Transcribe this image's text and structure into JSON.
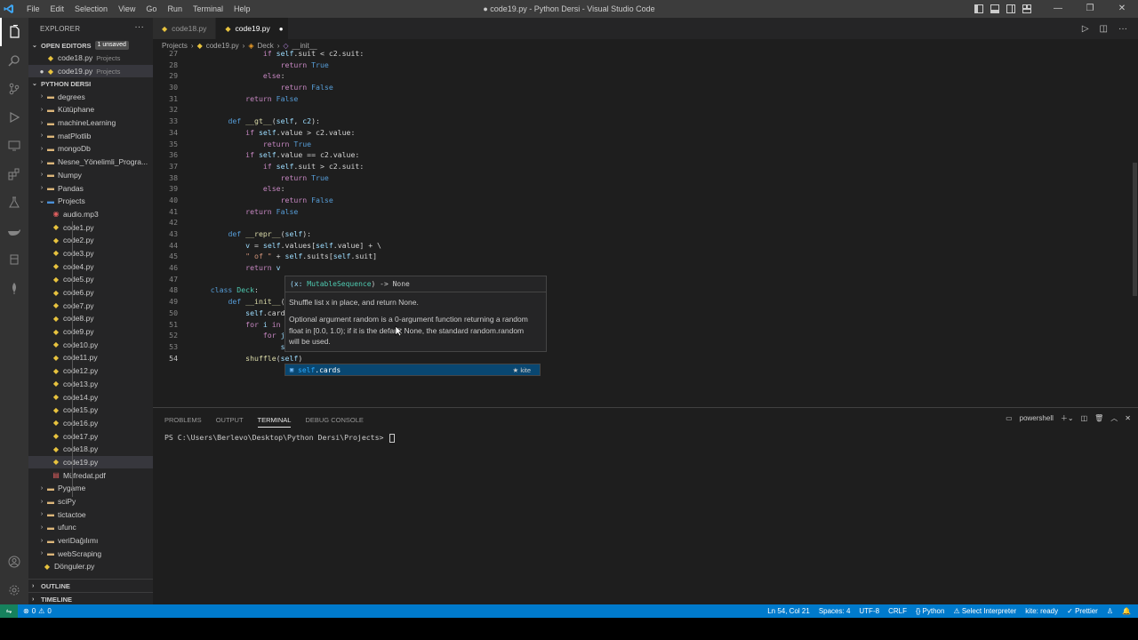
{
  "titlebar": {
    "menu": [
      "File",
      "Edit",
      "Selection",
      "View",
      "Go",
      "Run",
      "Terminal",
      "Help"
    ],
    "title": "● code19.py - Python Dersi - Visual Studio Code",
    "controls": [
      "—",
      "❐",
      "✕"
    ]
  },
  "sidebar": {
    "header": "EXPLORER",
    "open_editors": {
      "label": "OPEN EDITORS",
      "badge": "1 unsaved"
    },
    "open_files": [
      {
        "name": "code18.py",
        "folder": "Projects"
      },
      {
        "name": "code19.py",
        "folder": "Projects"
      }
    ],
    "workspace": "PYTHON DERSI",
    "folders_top": [
      "degrees",
      "Kütüphane",
      "machineLearning",
      "matPlotlib",
      "mongoDb",
      "Nesne_Yönelimli_Progra...",
      "Numpy",
      "Pandas"
    ],
    "projects_folder": "Projects",
    "project_files": [
      "audio.mp3",
      "code1.py",
      "code2.py",
      "code3.py",
      "code4.py",
      "code5.py",
      "code6.py",
      "code7.py",
      "code8.py",
      "code9.py",
      "code10.py",
      "code11.py",
      "code12.py",
      "code13.py",
      "code14.py",
      "code15.py",
      "code16.py",
      "code17.py",
      "code18.py",
      "code19.py",
      "Müfredat.pdf"
    ],
    "folders_bottom": [
      "Pygame",
      "sciPy",
      "tictactoe",
      "ufunc",
      "veriDağılımı",
      "webScraping"
    ],
    "file_bottom": "Dönguler.py",
    "outline": "OUTLINE",
    "timeline": "TIMELINE"
  },
  "tabs": [
    {
      "label": "code18.py"
    },
    {
      "label": "code19.py"
    }
  ],
  "breadcrumb": [
    "Projects",
    "code19.py",
    "Deck",
    "__init__"
  ],
  "code": {
    "lines": [
      {
        "n": "27",
        "segs": [
          [
            "                ",
            ""
          ],
          [
            "if ",
            "kw2"
          ],
          [
            "self",
            "self"
          ],
          [
            ".suit < c2.suit:",
            ""
          ]
        ]
      },
      {
        "n": "28",
        "segs": [
          [
            "                    ",
            ""
          ],
          [
            "return ",
            "kw2"
          ],
          [
            "True",
            "kw"
          ]
        ]
      },
      {
        "n": "29",
        "segs": [
          [
            "                ",
            ""
          ],
          [
            "else",
            "kw2"
          ],
          [
            ":",
            ""
          ]
        ]
      },
      {
        "n": "30",
        "segs": [
          [
            "                    ",
            ""
          ],
          [
            "return ",
            "kw2"
          ],
          [
            "False",
            "kw"
          ]
        ]
      },
      {
        "n": "31",
        "segs": [
          [
            "            ",
            ""
          ],
          [
            "return ",
            "kw2"
          ],
          [
            "False",
            "kw"
          ]
        ]
      },
      {
        "n": "32",
        "segs": [
          [
            "",
            ""
          ]
        ]
      },
      {
        "n": "33",
        "segs": [
          [
            "        ",
            ""
          ],
          [
            "def ",
            "kw"
          ],
          [
            "__gt__",
            "fnc"
          ],
          [
            "(",
            ""
          ],
          [
            "self",
            "self"
          ],
          [
            ", ",
            ""
          ],
          [
            "c2",
            "vr"
          ],
          [
            "):",
            ""
          ]
        ]
      },
      {
        "n": "34",
        "segs": [
          [
            "            ",
            ""
          ],
          [
            "if ",
            "kw2"
          ],
          [
            "self",
            "self"
          ],
          [
            ".value > c2.value:",
            ""
          ]
        ]
      },
      {
        "n": "35",
        "segs": [
          [
            "                ",
            ""
          ],
          [
            "return ",
            "kw2"
          ],
          [
            "True",
            "kw"
          ]
        ]
      },
      {
        "n": "36",
        "segs": [
          [
            "            ",
            ""
          ],
          [
            "if ",
            "kw2"
          ],
          [
            "self",
            "self"
          ],
          [
            ".value == c2.value:",
            ""
          ]
        ]
      },
      {
        "n": "37",
        "segs": [
          [
            "                ",
            ""
          ],
          [
            "if ",
            "kw2"
          ],
          [
            "self",
            "self"
          ],
          [
            ".suit > c2.suit:",
            ""
          ]
        ]
      },
      {
        "n": "38",
        "segs": [
          [
            "                    ",
            ""
          ],
          [
            "return ",
            "kw2"
          ],
          [
            "True",
            "kw"
          ]
        ]
      },
      {
        "n": "39",
        "segs": [
          [
            "                ",
            ""
          ],
          [
            "else",
            "kw2"
          ],
          [
            ":",
            ""
          ]
        ]
      },
      {
        "n": "40",
        "segs": [
          [
            "                    ",
            ""
          ],
          [
            "return ",
            "kw2"
          ],
          [
            "False",
            "kw"
          ]
        ]
      },
      {
        "n": "41",
        "segs": [
          [
            "            ",
            ""
          ],
          [
            "return ",
            "kw2"
          ],
          [
            "False",
            "kw"
          ]
        ]
      },
      {
        "n": "42",
        "segs": [
          [
            "",
            ""
          ]
        ]
      },
      {
        "n": "43",
        "segs": [
          [
            "        ",
            ""
          ],
          [
            "def ",
            "kw"
          ],
          [
            "__repr__",
            "fnc"
          ],
          [
            "(",
            ""
          ],
          [
            "self",
            "self"
          ],
          [
            "):",
            ""
          ]
        ]
      },
      {
        "n": "44",
        "segs": [
          [
            "            ",
            ""
          ],
          [
            "v",
            "vr"
          ],
          [
            " = ",
            ""
          ],
          [
            "self",
            "self"
          ],
          [
            ".values[",
            ""
          ],
          [
            "self",
            "self"
          ],
          [
            ".value] + \\",
            ""
          ]
        ]
      },
      {
        "n": "45",
        "segs": [
          [
            "            ",
            ""
          ],
          [
            "\" of \"",
            "str"
          ],
          [
            " + ",
            ""
          ],
          [
            "self",
            "self"
          ],
          [
            ".suits[",
            ""
          ],
          [
            "self",
            "self"
          ],
          [
            ".suit]",
            ""
          ]
        ]
      },
      {
        "n": "46",
        "segs": [
          [
            "            ",
            ""
          ],
          [
            "return ",
            "kw2"
          ],
          [
            "v",
            "vr"
          ]
        ]
      },
      {
        "n": "47",
        "segs": [
          [
            "",
            ""
          ]
        ]
      },
      {
        "n": "48",
        "segs": [
          [
            "    ",
            ""
          ],
          [
            "class ",
            "kw"
          ],
          [
            "Deck",
            "cn"
          ],
          [
            ":",
            ""
          ]
        ]
      },
      {
        "n": "49",
        "segs": [
          [
            "        ",
            ""
          ],
          [
            "def ",
            "kw"
          ],
          [
            "__init__",
            "fnc"
          ],
          [
            "(",
            ""
          ],
          [
            "sel",
            "self"
          ]
        ]
      },
      {
        "n": "50",
        "segs": [
          [
            "            ",
            ""
          ],
          [
            "self",
            "self"
          ],
          [
            ".cards =",
            ""
          ]
        ]
      },
      {
        "n": "51",
        "segs": [
          [
            "            ",
            ""
          ],
          [
            "for ",
            "kw2"
          ],
          [
            "i ",
            "vr"
          ],
          [
            "in ",
            "kw2"
          ],
          [
            "ran",
            "fnc"
          ]
        ]
      },
      {
        "n": "52",
        "segs": [
          [
            "                ",
            ""
          ],
          [
            "for ",
            "kw2"
          ],
          [
            "j ",
            "vr"
          ],
          [
            "in",
            "kw2"
          ]
        ]
      },
      {
        "n": "53",
        "segs": [
          [
            "                    ",
            ""
          ],
          [
            "self",
            "self"
          ]
        ]
      },
      {
        "n": "54",
        "segs": [
          [
            "            ",
            ""
          ],
          [
            "shuffle",
            "fnc"
          ],
          [
            "(",
            ""
          ],
          [
            "self",
            "self"
          ],
          [
            ")",
            ""
          ]
        ]
      }
    ]
  },
  "hover": {
    "signature_param": "(x: ",
    "signature_type": "MutableSequence",
    "signature_ret": ") -> None",
    "line1": "Shuffle list x in place, and return None.",
    "line2": "Optional argument random is a 0-argument function returning a random float in [0.0, 1.0); if it is the default None, the standard random.random will be used."
  },
  "suggest": {
    "prefix": "self",
    "rest": ".cards",
    "source": "★ kite"
  },
  "panel": {
    "tabs": [
      "PROBLEMS",
      "OUTPUT",
      "TERMINAL",
      "DEBUG CONSOLE"
    ],
    "active_tab": "TERMINAL",
    "shell": "powershell",
    "prompt": "PS C:\\Users\\Berlevo\\Desktop\\Python Dersi\\Projects> "
  },
  "status": {
    "errors": "0",
    "warnings": "0",
    "position": "Ln 54, Col 21",
    "spaces": "Spaces: 4",
    "encoding": "UTF-8",
    "eol": "CRLF",
    "language": "Python",
    "interpreter": "Select Interpreter",
    "kite": "kite: ready",
    "prettier": "Prettier"
  },
  "colors": {
    "accent": "#007acc",
    "remote": "#16825d",
    "sidebar": "#252526",
    "editor": "#1e1e1e"
  }
}
